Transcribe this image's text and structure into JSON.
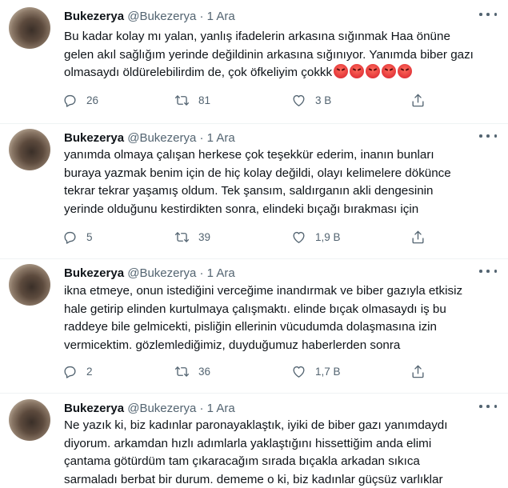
{
  "tweets": [
    {
      "name": "Bukezerya",
      "handle": "@Bukezerya",
      "dot": "·",
      "date": "1 Ara",
      "lines": [
        "Bu kadar kolay mı yalan, yanlış ifadelerin arkasına sığınmak Haa önüne",
        "gelen akıl sağlığım yerinde değildinin arkasına sığınıyor. Yanımda biber gazı",
        "olmasaydı öldürelebilirdim de, çok öfkeliyim çokkk"
      ],
      "emoji": "pouting-face",
      "replies": "26",
      "retweets": "81",
      "likes": "3 B"
    },
    {
      "name": "Bukezerya",
      "handle": "@Bukezerya",
      "dot": "·",
      "date": "1 Ara",
      "lines": [
        "yanımda olmaya çalışan herkese çok teşekkür ederim, inanın bunları",
        "buraya yazmak benim için de hiç kolay değildi, olayı kelimelere dökünce",
        "tekrar tekrar yaşamış oldum. Tek şansım, saldırganın akli dengesinin",
        "yerinde olduğunu kestirdikten sonra, elindeki bıçağı bırakması için"
      ],
      "replies": "5",
      "retweets": "39",
      "likes": "1,9 B"
    },
    {
      "name": "Bukezerya",
      "handle": "@Bukezerya",
      "dot": "·",
      "date": "1 Ara",
      "lines": [
        "ikna etmeye, onun istediğini verceğime inandırmak ve biber gazıyla etkisiz",
        "hale getirip elinden kurtulmaya çalışmaktı. elinde bıçak olmasaydı iş bu",
        "raddeye bile gelmicekti, pisliğin ellerinin vücudumda dolaşmasına izin",
        "vermicektim. gözlemlediğimiz, duyduğumuz haberlerden sonra"
      ],
      "replies": "2",
      "retweets": "36",
      "likes": "1,7 B"
    },
    {
      "name": "Bukezerya",
      "handle": "@Bukezerya",
      "dot": "·",
      "date": "1 Ara",
      "lines": [
        "Ne yazık ki, biz kadınlar paronayaklaştık, iyiki de biber gazı yanımdaydı",
        "diyorum. arkamdan hızlı adımlarla yaklaştığını hissettiğim anda elimi",
        "çantama götürdüm tam çıkaracağım sırada bıçakla arkadan sıkıca",
        "sarmaladı berbat bir durum. dememe o ki, biz kadınlar güçsüz varlıklar"
      ]
    }
  ],
  "icons": {
    "reply": "reply-icon",
    "retweet": "retweet-icon",
    "like": "heart-icon",
    "share": "share-icon",
    "more": "more-icon"
  }
}
